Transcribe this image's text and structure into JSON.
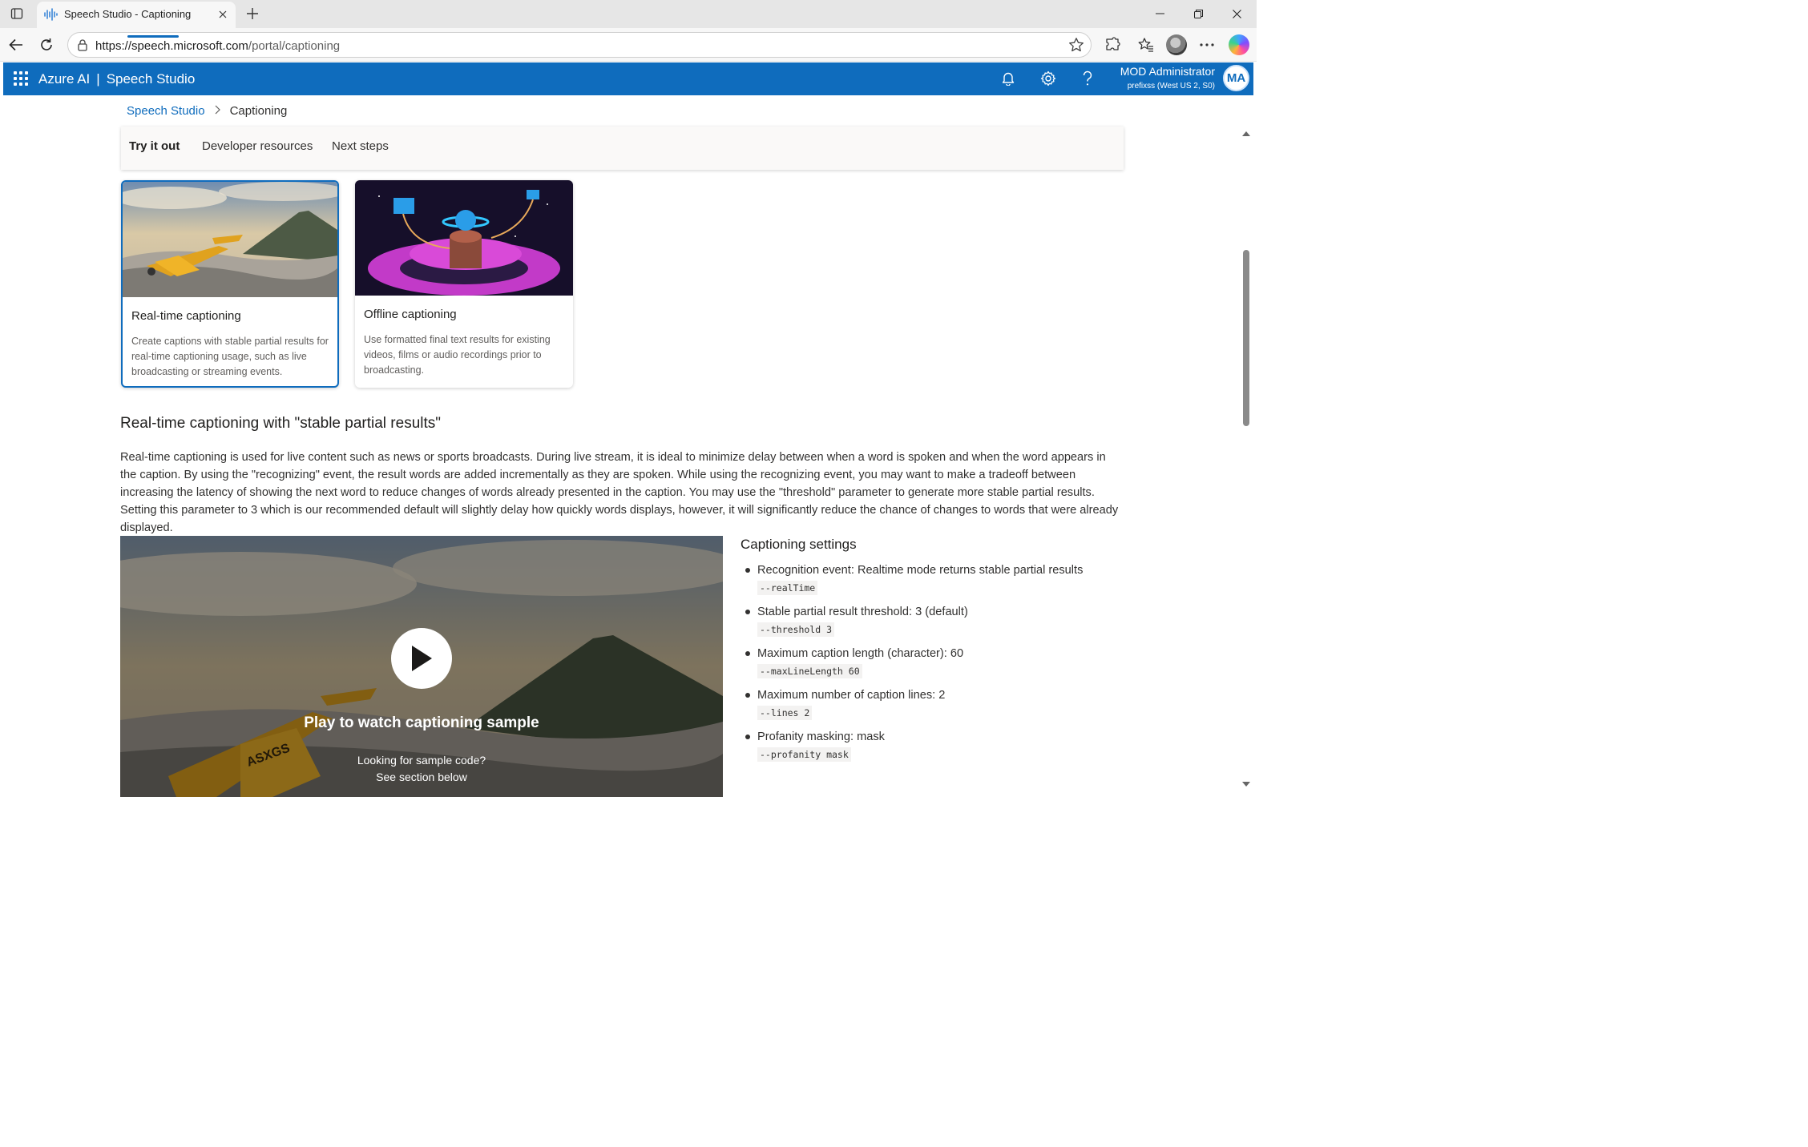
{
  "browser": {
    "tab_title": "Speech Studio - Captioning",
    "url_host": "https://speech.microsoft.com",
    "url_path": "/portal/captioning"
  },
  "header": {
    "brand": "Azure AI",
    "separator": "|",
    "product": "Speech Studio",
    "user_name": "MOD Administrator",
    "user_subtitle": "prefixss (West US 2, S0)",
    "avatar_initials": "MA"
  },
  "breadcrumb": {
    "root": "Speech Studio",
    "current": "Captioning"
  },
  "tabs": [
    "Try it out",
    "Developer resources",
    "Next steps"
  ],
  "cards": [
    {
      "title": "Real-time captioning",
      "description": "Create captions with stable partial results for real-time captioning usage, such as live broadcasting or streaming events."
    },
    {
      "title": "Offline captioning",
      "description": "Use formatted final text results for existing videos, films or audio recordings prior to broadcasting."
    }
  ],
  "section": {
    "heading": "Real-time captioning with \"stable partial results\"",
    "paragraph": "Real-time captioning is used for live content such as news or sports broadcasts. During live stream, it is ideal to minimize delay between when a word is spoken and when the word appears in the caption. By using the \"recognizing\" event, the result words are added incrementally as they are spoken. While using the recognizing event, you may want to make a tradeoff between increasing the latency of showing the next word to reduce changes of words already presented in the caption. You may use the \"threshold\" parameter to generate more stable partial results. Setting this parameter to 3 which is our recommended default will slightly delay how quickly words displays, however, it will significantly reduce the chance of changes to words that were already displayed."
  },
  "video": {
    "play_title": "Play to watch captioning sample",
    "sample_line1": "Looking for sample code?",
    "sample_line2": "See section below",
    "plane_tail": "ASXGS"
  },
  "settings": {
    "heading": "Captioning settings",
    "items": [
      {
        "text": "Recognition event: Realtime mode returns stable partial results",
        "code": "--realTime"
      },
      {
        "text": "Stable partial result threshold: 3 (default)",
        "code": "--threshold 3"
      },
      {
        "text": "Maximum caption length (character): 60",
        "code": "--maxLineLength 60"
      },
      {
        "text": "Maximum number of caption lines: 2",
        "code": "--lines 2"
      },
      {
        "text": "Profanity masking: mask",
        "code": "--profanity mask"
      }
    ]
  },
  "colors": {
    "accent": "#0f6cbd",
    "header_bg": "#0f6cbd"
  }
}
